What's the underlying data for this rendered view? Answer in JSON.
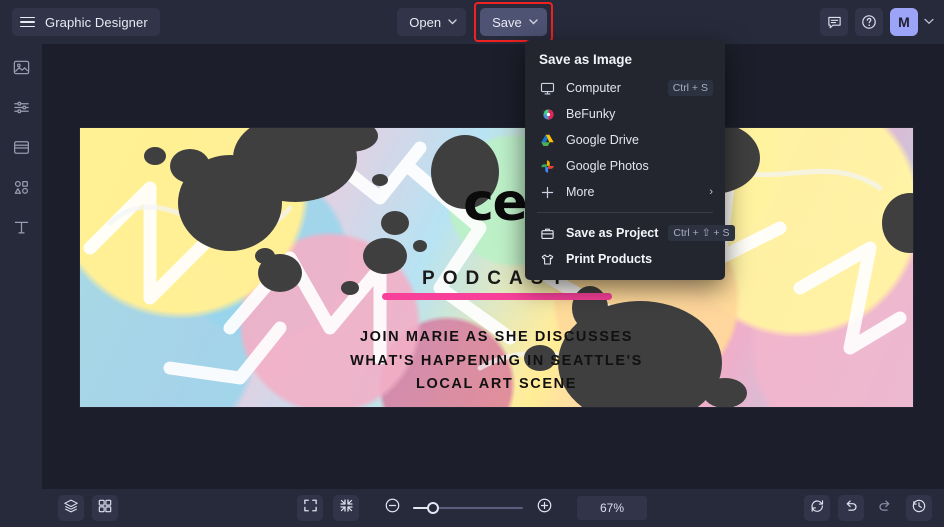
{
  "app": {
    "name": "Graphic Designer",
    "menu_icon": "hamburger-icon"
  },
  "toolbar": {
    "open_label": "Open",
    "save_label": "Save",
    "caret": "⌄",
    "highlight_color": "#ee2222",
    "accent_color": "#9ba4f7"
  },
  "topright": {
    "feedback_icon": "chat-bubble-icon",
    "help_icon": "question-circle-icon",
    "avatar_initial": "M",
    "avatar_caret": "⌄"
  },
  "sidebar": {
    "items": [
      {
        "name": "image",
        "icon": "image-icon"
      },
      {
        "name": "edit",
        "icon": "sliders-icon"
      },
      {
        "name": "templates",
        "icon": "layout-icon"
      },
      {
        "name": "graphics",
        "icon": "shapes-icon"
      },
      {
        "name": "text",
        "icon": "text-icon"
      }
    ]
  },
  "save_menu": {
    "title": "Save as Image",
    "items": [
      {
        "label": "Computer",
        "icon": "monitor-icon",
        "shortcut": "Ctrl + S",
        "arrow": "",
        "strong": false
      },
      {
        "label": "BeFunky",
        "icon": "befunky-logo-icon",
        "shortcut": "",
        "arrow": "",
        "strong": false
      },
      {
        "label": "Google Drive",
        "icon": "google-drive-icon",
        "shortcut": "",
        "arrow": "",
        "strong": false
      },
      {
        "label": "Google Photos",
        "icon": "google-photos-icon",
        "shortcut": "",
        "arrow": "",
        "strong": false
      },
      {
        "label": "More",
        "icon": "plus-icon",
        "shortcut": "",
        "arrow": "›",
        "strong": false
      }
    ],
    "footer_items": [
      {
        "label": "Save as Project",
        "icon": "briefcase-icon",
        "shortcut": "Ctrl + ⇧ + S",
        "strong": true
      },
      {
        "label": "Print Products",
        "icon": "tshirt-icon",
        "shortcut": "",
        "strong": true
      }
    ]
  },
  "canvas": {
    "artwork": {
      "headline": "ce",
      "subtitle": "PODCAST",
      "underline_color": "#f8409a",
      "body_lines": [
        "JOIN MARIE AS SHE DISCUSSES",
        "WHAT'S HAPPENING IN SEATTLE'S",
        "LOCAL ART SCENE"
      ]
    }
  },
  "bottombar": {
    "left_tools": [
      {
        "name": "layers",
        "icon": "layers-icon"
      },
      {
        "name": "grid",
        "icon": "grid-icon"
      }
    ],
    "view_tools": [
      {
        "name": "fullscreen",
        "icon": "expand-icon"
      },
      {
        "name": "fit-to-screen",
        "icon": "collapse-icon"
      }
    ],
    "zoom_out_icon": "minus-circle-icon",
    "zoom_in_icon": "plus-circle-icon",
    "zoom_value": "67%",
    "right_tools": [
      {
        "name": "reset",
        "icon": "reset-icon"
      },
      {
        "name": "undo",
        "icon": "undo-icon"
      },
      {
        "name": "redo",
        "icon": "redo-icon"
      },
      {
        "name": "history",
        "icon": "history-icon"
      }
    ]
  }
}
